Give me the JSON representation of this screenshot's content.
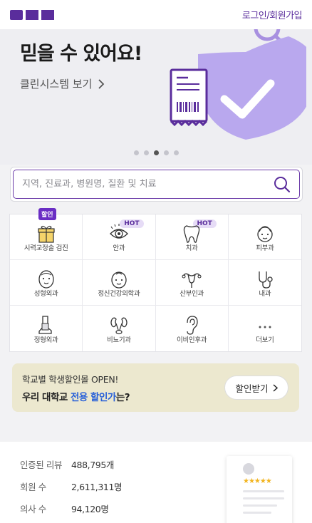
{
  "header": {
    "logo_alt": "OCC",
    "login_link": "로그인/회원가입"
  },
  "hero": {
    "title_line": "믿을 수 있어요!",
    "link_label": "클린시스템 보기",
    "dots": 5,
    "active_dot": 3
  },
  "search": {
    "placeholder": "지역, 진료과, 병원명, 질환 및 치료"
  },
  "categories": [
    {
      "label": "시력교정술 검진",
      "icon": "gift-box-icon",
      "badge": "할인"
    },
    {
      "label": "안과",
      "icon": "eye-icon",
      "badge": "HOT"
    },
    {
      "label": "치과",
      "icon": "tooth-icon",
      "badge": "HOT"
    },
    {
      "label": "피부과",
      "icon": "face-skin-icon",
      "badge": ""
    },
    {
      "label": "성형외과",
      "icon": "face-icon",
      "badge": ""
    },
    {
      "label": "정신건강의학과",
      "icon": "mind-face-icon",
      "badge": ""
    },
    {
      "label": "산부인과",
      "icon": "uterus-icon",
      "badge": ""
    },
    {
      "label": "내과",
      "icon": "stethoscope-icon",
      "badge": ""
    },
    {
      "label": "정형외과",
      "icon": "cast-leg-icon",
      "badge": ""
    },
    {
      "label": "비뇨기과",
      "icon": "kidney-icon",
      "badge": ""
    },
    {
      "label": "이비인후과",
      "icon": "ear-icon",
      "badge": ""
    },
    {
      "label": "더보기",
      "icon": "more-dots-icon",
      "badge": ""
    }
  ],
  "promo": {
    "line1": "학교별 학생할인몰 OPEN!",
    "line2_a": "우리 대학교 ",
    "line2_highlight": "전용 할인가",
    "line2_b": "는?",
    "button_label": "할인받기",
    "background": "#ece8cf"
  },
  "stats": {
    "rows": [
      {
        "label": "인증된 리뷰",
        "value": "488,795개"
      },
      {
        "label": "회원 수",
        "value": "2,611,311명"
      },
      {
        "label": "의사 수",
        "value": "94,120명"
      }
    ],
    "stars": "★★★★★"
  },
  "colors": {
    "brand": "#5a2d9c",
    "accent_blue": "#2860d8",
    "badge_bg": "#6a2ec4"
  }
}
